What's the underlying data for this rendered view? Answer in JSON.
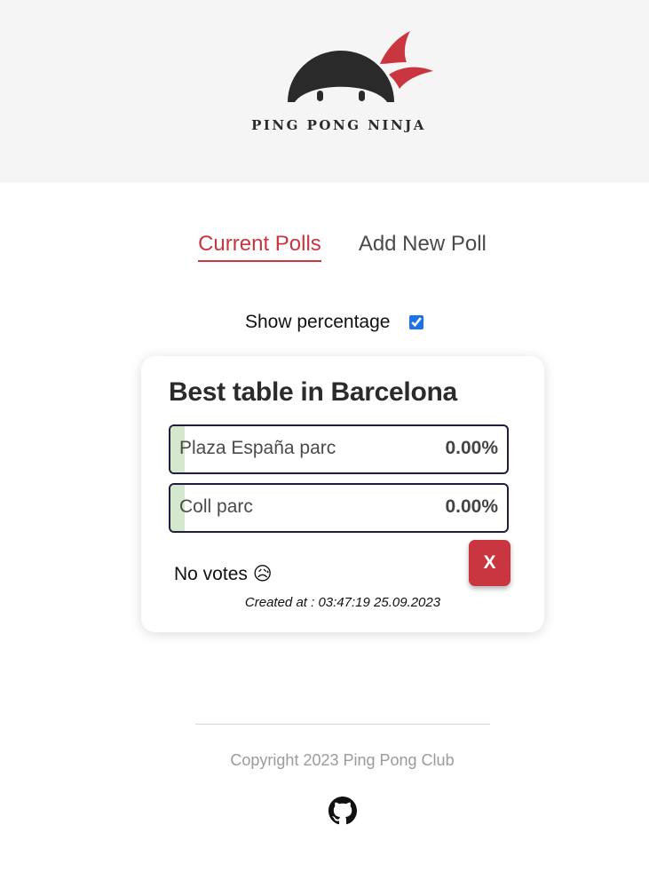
{
  "header": {
    "brand": "PING PONG NINJA"
  },
  "tabs": [
    {
      "label": "Current Polls",
      "active": true
    },
    {
      "label": "Add New Poll",
      "active": false
    }
  ],
  "options_bar": {
    "show_percentage_label": "Show percentage",
    "show_percentage_checked": true
  },
  "poll": {
    "title": "Best table in Barcelona",
    "options": [
      {
        "label": "Plaza España parc",
        "percent": "0.00%"
      },
      {
        "label": "Coll parc",
        "percent": "0.00%"
      }
    ],
    "no_votes_text": "No votes 😥",
    "delete_label": "X",
    "created_text": "Created at : 03:47:19 25.09.2023"
  },
  "footer": {
    "copyright": "Copyright 2023 Ping Pong Club"
  },
  "icons": {
    "github": "github-icon",
    "logo": "ninja-logo"
  },
  "colors": {
    "accent": "#c9363f",
    "header_bg": "#f5f5f5",
    "vote_fill": "#d4e8cd"
  }
}
